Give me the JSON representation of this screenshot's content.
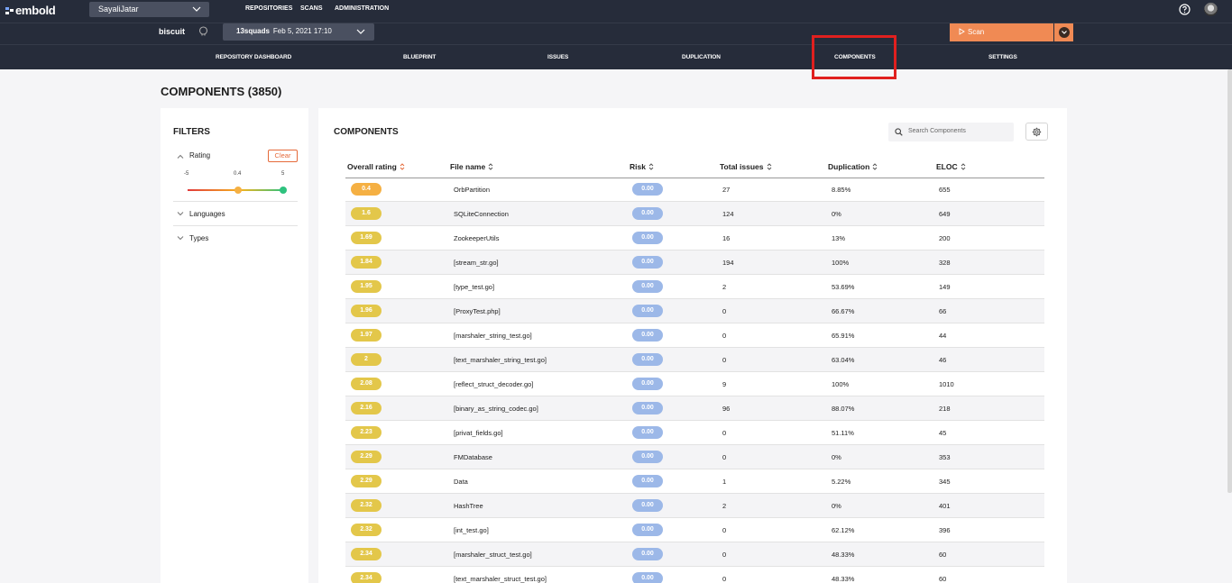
{
  "app": {
    "logo_text": "embold",
    "org": "SayaliJatar"
  },
  "top_nav": [
    "REPOSITORIES",
    "SCANS",
    "ADMINISTRATION"
  ],
  "repo": {
    "name": "biscuit",
    "scan_user": "13squads",
    "scan_date": "Feb 5, 2021 17:10",
    "scan_button": "Scan"
  },
  "section_nav": [
    "REPOSITORY DASHBOARD",
    "BLUEPRINT",
    "ISSUES",
    "DUPLICATION",
    "COMPONENTS",
    "SETTINGS"
  ],
  "active_section": "COMPONENTS",
  "page_title": "COMPONENTS (3850)",
  "filters": {
    "title": "FILTERS",
    "rating_label": "Rating",
    "clear_label": "Clear",
    "slider_labels": [
      "-5",
      "0.4",
      "5"
    ],
    "slider_range": [
      0.4,
      5
    ],
    "languages_label": "Languages",
    "types_label": "Types"
  },
  "components": {
    "title": "COMPONENTS",
    "search_placeholder": "Search Components",
    "columns": [
      "Overall rating",
      "File name",
      "Risk",
      "Total issues",
      "Duplication",
      "ELOC"
    ],
    "rows": [
      {
        "rating": "0.4",
        "file": "OrbPartition",
        "risk": "0.00",
        "issues": "27",
        "dup": "8.85%",
        "eloc": "655"
      },
      {
        "rating": "1.6",
        "file": "SQLiteConnection",
        "risk": "0.00",
        "issues": "124",
        "dup": "0%",
        "eloc": "649"
      },
      {
        "rating": "1.69",
        "file": "ZookeeperUtils",
        "risk": "0.00",
        "issues": "16",
        "dup": "13%",
        "eloc": "200"
      },
      {
        "rating": "1.84",
        "file": "[stream_str.go]",
        "risk": "0.00",
        "issues": "194",
        "dup": "100%",
        "eloc": "328"
      },
      {
        "rating": "1.95",
        "file": "[type_test.go]",
        "risk": "0.00",
        "issues": "2",
        "dup": "53.69%",
        "eloc": "149"
      },
      {
        "rating": "1.96",
        "file": "[ProxyTest.php]",
        "risk": "0.00",
        "issues": "0",
        "dup": "66.67%",
        "eloc": "66"
      },
      {
        "rating": "1.97",
        "file": "[marshaler_string_test.go]",
        "risk": "0.00",
        "issues": "0",
        "dup": "65.91%",
        "eloc": "44"
      },
      {
        "rating": "2",
        "file": "[text_marshaler_string_test.go]",
        "risk": "0.00",
        "issues": "0",
        "dup": "63.04%",
        "eloc": "46"
      },
      {
        "rating": "2.08",
        "file": "[reflect_struct_decoder.go]",
        "risk": "0.00",
        "issues": "9",
        "dup": "100%",
        "eloc": "1010"
      },
      {
        "rating": "2.16",
        "file": "[binary_as_string_codec.go]",
        "risk": "0.00",
        "issues": "96",
        "dup": "88.07%",
        "eloc": "218"
      },
      {
        "rating": "2.23",
        "file": "[privat_fields.go]",
        "risk": "0.00",
        "issues": "0",
        "dup": "51.11%",
        "eloc": "45"
      },
      {
        "rating": "2.29",
        "file": "FMDatabase",
        "risk": "0.00",
        "issues": "0",
        "dup": "0%",
        "eloc": "353"
      },
      {
        "rating": "2.29",
        "file": "Data",
        "risk": "0.00",
        "issues": "1",
        "dup": "5.22%",
        "eloc": "345"
      },
      {
        "rating": "2.32",
        "file": "HashTree",
        "risk": "0.00",
        "issues": "2",
        "dup": "0%",
        "eloc": "401"
      },
      {
        "rating": "2.32",
        "file": "[int_test.go]",
        "risk": "0.00",
        "issues": "0",
        "dup": "62.12%",
        "eloc": "396"
      },
      {
        "rating": "2.34",
        "file": "[marshaler_struct_test.go]",
        "risk": "0.00",
        "issues": "0",
        "dup": "48.33%",
        "eloc": "60"
      },
      {
        "rating": "2.34",
        "file": "[text_marshaler_struct_test.go]",
        "risk": "0.00",
        "issues": "0",
        "dup": "48.33%",
        "eloc": "60"
      }
    ]
  },
  "colors": {
    "topbar": "#262c3a",
    "accent": "#f08a54",
    "rating_orange": "#f5b043",
    "rating_yellow": "#e3c74a",
    "risk": "#9cb8e8",
    "highlight": "#e0201f"
  }
}
